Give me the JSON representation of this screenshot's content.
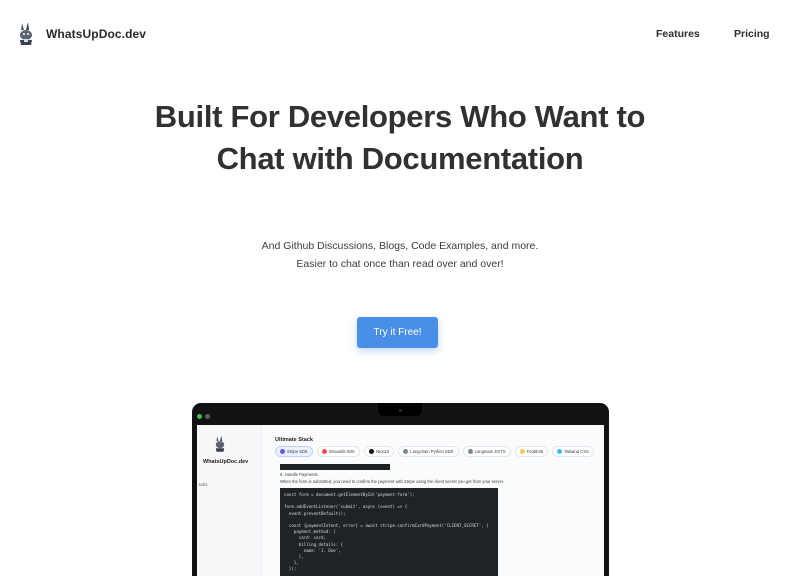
{
  "nav": {
    "brand": "WhatsUpDoc.dev",
    "links": [
      "Features",
      "Pricing"
    ]
  },
  "hero": {
    "title": "Built For Developers Who Want to Chat with Documentation",
    "subtitle_line1": "And Github Discussions, Blogs, Code Examples, and more.",
    "subtitle_line2": "Easier to chat once than read over and over!",
    "cta_label": "Try it Free!"
  },
  "colors": {
    "accent": "#4a8fe7",
    "heading": "#2f3133"
  },
  "mockup": {
    "brand": "WhatsUpDoc.dev",
    "sidebar_item": "tabs",
    "stack_title": "Ultimate Stack",
    "chips": [
      {
        "label": "Stripe SDK",
        "icon": "stripe-icon",
        "active": true
      },
      {
        "label": "Streamlit SDK",
        "icon": "streamlit-icon",
        "active": false
      },
      {
        "label": "Next15",
        "icon": "nextjs-icon",
        "active": false
      },
      {
        "label": "Langchain Python SDK",
        "icon": "langchain-icon",
        "active": false
      },
      {
        "label": "Langmain JS/TS",
        "icon": "langchain-icon",
        "active": false
      },
      {
        "label": "Foobb35",
        "icon": "foobb-icon",
        "active": false
      },
      {
        "label": "Tailwind CSS",
        "icon": "tailwind-icon",
        "active": false
      }
    ],
    "doc_heading": "5. Handle Payments",
    "doc_text": "When the form is submitted, you need to confirm the payment with Stripe using the client secret you get from your server.",
    "code_lines": [
      "const form = document.getElementById('payment-form');",
      "",
      "form.addEventListener('submit', async (event) => {",
      "  event.preventDefault();",
      "",
      "  const {paymentIntent, error} = await stripe.confirmCardPayment('CLIENT_SECRET', {",
      "    payment_method: {",
      "      card: card,",
      "      billing_details: {",
      "        name: 'J. Doe',",
      "      },",
      "    },",
      "  });"
    ]
  }
}
